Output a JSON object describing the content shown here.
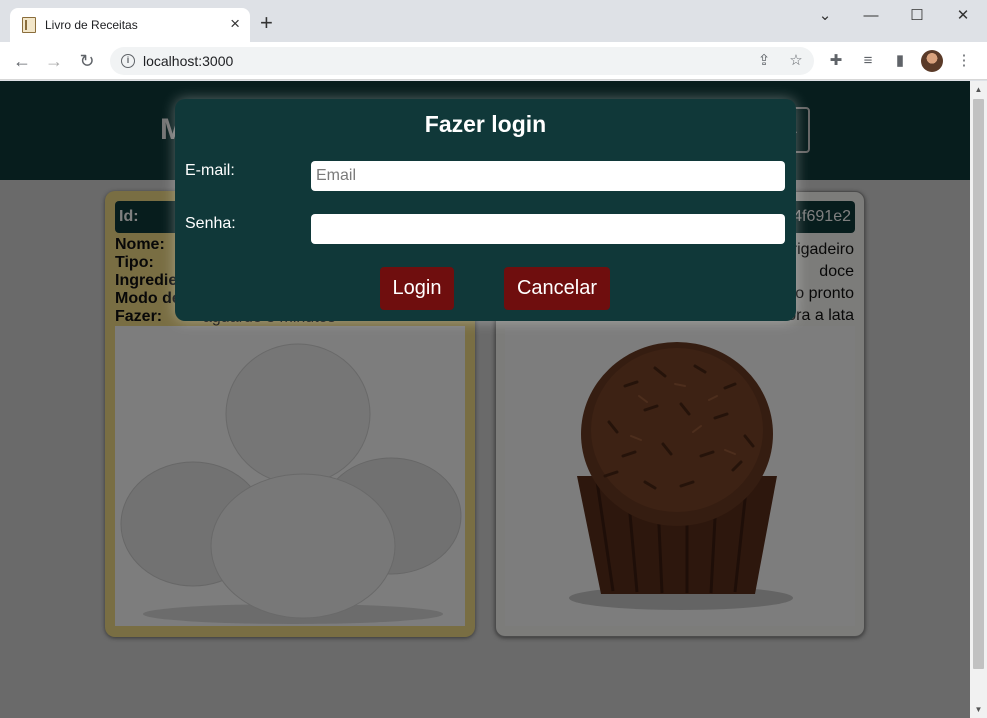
{
  "browser": {
    "tab_title": "Livro de Receitas",
    "url": "localhost:3000",
    "icons": {
      "tab_close": "×",
      "new_tab": "+",
      "dropdown": "⌄",
      "minimize": "—",
      "maximize": "☐",
      "close": "✕",
      "back": "←",
      "forward": "→",
      "reload": "↻",
      "info": "i",
      "share": "⇪",
      "star": "☆",
      "extensions": "✚",
      "media": "≡",
      "side_panel": "▮",
      "menu": "⋮"
    }
  },
  "page": {
    "title_visible": "M",
    "menu_glyph": "⌄",
    "card_left": {
      "id_label": "Id:",
      "labels": {
        "nome": "Nome:",
        "tipo": "Tipo:",
        "ingredientes": "Ingredie",
        "modo1": "Modo de",
        "modo2": "Fazer:"
      },
      "modo_value": "aguarde 3 minutos",
      "image": "eggs"
    },
    "card_right": {
      "id_value": "4f691e2",
      "values": [
        "rigadeiro",
        "doce",
        "o pronto",
        "ora a lata"
      ],
      "image": "brigadeiro"
    }
  },
  "modal": {
    "title": "Fazer login",
    "email_label": "E-mail:",
    "email_placeholder": "Email",
    "email_value": "",
    "password_label": "Senha:",
    "password_value": "",
    "login_button": "Login",
    "cancel_button": "Cancelar"
  },
  "colors": {
    "header_bg": "#0f3b3a",
    "modal_bg": "#103839",
    "button_bg": "#6f0e0e",
    "card_left_bg": "#f3dd86"
  }
}
